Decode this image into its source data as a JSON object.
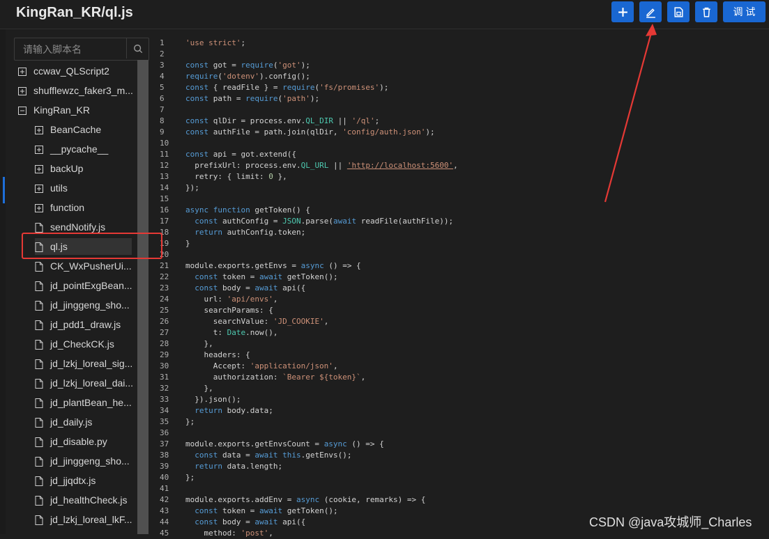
{
  "header": {
    "title": "KingRan_KR/ql.js",
    "buttons": {
      "add_icon": "plus-icon",
      "edit_icon": "edit-icon",
      "save_icon": "save-icon",
      "delete_icon": "trash-icon",
      "debug_label": "调 试"
    }
  },
  "sidebar": {
    "search_placeholder": "请输入脚本名",
    "tree": [
      {
        "label": "ccwav_QLScript2",
        "type": "folder",
        "level": 0
      },
      {
        "label": "shufflewzc_faker3_m...",
        "type": "folder",
        "level": 0
      },
      {
        "label": "KingRan_KR",
        "type": "folder-open",
        "level": 0
      },
      {
        "label": "BeanCache",
        "type": "folder",
        "level": 1
      },
      {
        "label": "__pycache__",
        "type": "folder",
        "level": 1
      },
      {
        "label": "backUp",
        "type": "folder",
        "level": 1
      },
      {
        "label": "utils",
        "type": "folder",
        "level": 1
      },
      {
        "label": "function",
        "type": "folder",
        "level": 1
      },
      {
        "label": "sendNotify.js",
        "type": "file",
        "level": 1
      },
      {
        "label": "ql.js",
        "type": "file",
        "level": 1,
        "selected": true
      },
      {
        "label": "CK_WxPusherUi...",
        "type": "file",
        "level": 1
      },
      {
        "label": "jd_pointExgBean...",
        "type": "file",
        "level": 1
      },
      {
        "label": "jd_jinggeng_sho...",
        "type": "file",
        "level": 1
      },
      {
        "label": "jd_pdd1_draw.js",
        "type": "file",
        "level": 1
      },
      {
        "label": "jd_CheckCK.js",
        "type": "file",
        "level": 1
      },
      {
        "label": "jd_lzkj_loreal_sig...",
        "type": "file",
        "level": 1
      },
      {
        "label": "jd_lzkj_loreal_dai...",
        "type": "file",
        "level": 1
      },
      {
        "label": "jd_plantBean_he...",
        "type": "file",
        "level": 1
      },
      {
        "label": "jd_daily.js",
        "type": "file",
        "level": 1
      },
      {
        "label": "jd_disable.py",
        "type": "file",
        "level": 1
      },
      {
        "label": "jd_jinggeng_sho...",
        "type": "file",
        "level": 1
      },
      {
        "label": "jd_jjqdtx.js",
        "type": "file",
        "level": 1
      },
      {
        "label": "jd_healthCheck.js",
        "type": "file",
        "level": 1
      },
      {
        "label": "jd_lzkj_loreal_lkF...",
        "type": "file",
        "level": 1
      }
    ]
  },
  "editor": {
    "line_numbers": [
      "1",
      "2",
      "3",
      "4",
      "5",
      "6",
      "7",
      "8",
      "9",
      "10",
      "11",
      "12",
      "13",
      "14",
      "15",
      "16",
      "17",
      "18",
      "19",
      "20",
      "21",
      "22",
      "23",
      "24",
      "25",
      "26",
      "27",
      "28",
      "29",
      "30",
      "31",
      "32",
      "33",
      "34",
      "35",
      "36",
      "37",
      "38",
      "39",
      "40",
      "41",
      "42",
      "43",
      "44",
      "45"
    ],
    "code": [
      "'use strict';",
      "",
      "const got = require('got');",
      "require('dotenv').config();",
      "const { readFile } = require('fs/promises');",
      "const path = require('path');",
      "",
      "const qlDir = process.env.QL_DIR || '/ql';",
      "const authFile = path.join(qlDir, 'config/auth.json');",
      "",
      "const api = got.extend({",
      "  prefixUrl: process.env.QL_URL || 'http://localhost:5600',",
      "  retry: { limit: 0 },",
      "});",
      "",
      "async function getToken() {",
      "  const authConfig = JSON.parse(await readFile(authFile));",
      "  return authConfig.token;",
      "}",
      "",
      "module.exports.getEnvs = async () => {",
      "  const token = await getToken();",
      "  const body = await api({",
      "    url: 'api/envs',",
      "    searchParams: {",
      "      searchValue: 'JD_COOKIE',",
      "      t: Date.now(),",
      "    },",
      "    headers: {",
      "      Accept: 'application/json',",
      "      authorization: `Bearer ${token}`,",
      "    },",
      "  }).json();",
      "  return body.data;",
      "};",
      "",
      "module.exports.getEnvsCount = async () => {",
      "  const data = await this.getEnvs();",
      "  return data.length;",
      "};",
      "",
      "module.exports.addEnv = async (cookie, remarks) => {",
      "  const token = await getToken();",
      "  const body = await api({",
      "    method: 'post',"
    ]
  },
  "watermark": "CSDN @java攻城师_Charles",
  "colors": {
    "accent": "#1967d2",
    "annotation_red": "#e53935"
  }
}
